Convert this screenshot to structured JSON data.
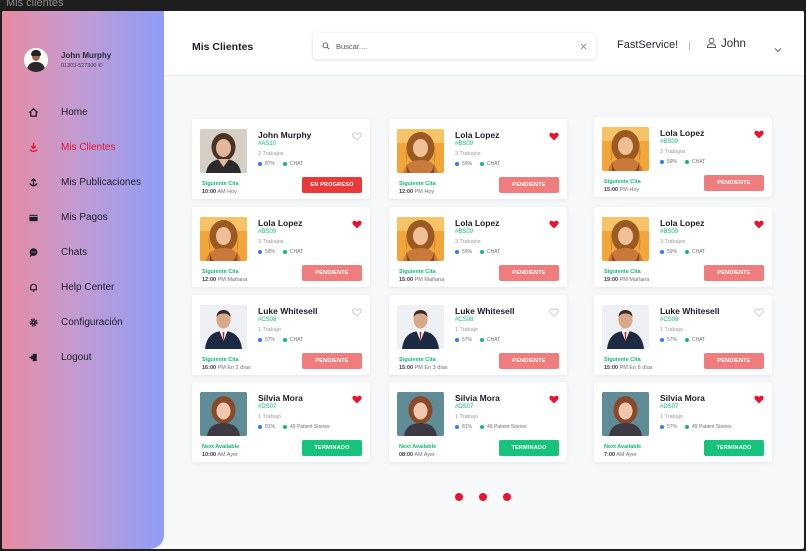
{
  "window": {
    "title": "Mis clientes"
  },
  "sidebar": {
    "profile": {
      "name": "John Murphy",
      "phone": "01303-527300"
    },
    "items": [
      {
        "label": "Home",
        "icon": "home-icon"
      },
      {
        "label": "Mis Clientes",
        "icon": "download-icon",
        "active": true
      },
      {
        "label": "Mis Publicaciones",
        "icon": "anchor-icon"
      },
      {
        "label": "Mis Pagos",
        "icon": "wallet-icon"
      },
      {
        "label": "Chats",
        "icon": "chat-icon"
      },
      {
        "label": "Help Center",
        "icon": "bell-icon"
      },
      {
        "label": "Configuración",
        "icon": "gear-icon"
      },
      {
        "label": "Logout",
        "icon": "logout-icon"
      }
    ]
  },
  "header": {
    "title": "Mis Clientes",
    "search_placeholder": "Buscar....",
    "brand": "FastService!",
    "user": "John"
  },
  "colors": {
    "accent": "#e8132f",
    "green": "#13b873",
    "blue": "#2f7cf6",
    "progress": "#e83a3a",
    "pending": "#f07d7d",
    "done": "#17c27b"
  },
  "cards": [
    {
      "name": "John Murphy",
      "code": "#AS10",
      "jobs": "2 Trabajos",
      "stat1": "87%",
      "stat2": "CHAT",
      "next_label": "Siguiente Cita",
      "next_time": "10:00",
      "next_when": "AM Hoy",
      "status": "EN PROGRESO",
      "favorite": false,
      "photo": "woman-dark"
    },
    {
      "name": "Lola Lopez",
      "code": "#BS09",
      "jobs": "3 Trabajos",
      "stat1": "59%",
      "stat2": "CHAT",
      "next_label": "Siguiente Cita",
      "next_time": "12:00",
      "next_when": "PM Hoy",
      "status": "PENDIENTE",
      "favorite": true,
      "photo": "woman-blonde"
    },
    {
      "name": "Lola Lopez",
      "code": "#BS09",
      "jobs": "3 Trabajos",
      "stat1": "59%",
      "stat2": "CHAT",
      "next_label": "Siguiente Cita",
      "next_time": "15:00",
      "next_when": "PM Hoy",
      "status": "PENDIENTE",
      "favorite": true,
      "photo": "woman-blonde"
    },
    {
      "name": "Lola Lopez",
      "code": "#BS09",
      "jobs": "3 Trabajos",
      "stat1": "59%",
      "stat2": "CHAT",
      "next_label": "Siguiente Cita",
      "next_time": "12:00",
      "next_when": "PM Mañana",
      "status": "PENDIENTE",
      "favorite": true,
      "photo": "woman-blonde"
    },
    {
      "name": "Lola Lopez",
      "code": "#BS09",
      "jobs": "3 Trabajos",
      "stat1": "59%",
      "stat2": "CHAT",
      "next_label": "Siguiente Cita",
      "next_time": "15:00",
      "next_when": "PM Mañana",
      "status": "PENDIENTE",
      "favorite": true,
      "photo": "woman-blonde"
    },
    {
      "name": "Lola Lopez",
      "code": "#BS09",
      "jobs": "3 Trabajos",
      "stat1": "59%",
      "stat2": "CHAT",
      "next_label": "Siguiente Cita",
      "next_time": "19:00",
      "next_when": "PM Mañana",
      "status": "PENDIENTE",
      "favorite": true,
      "photo": "woman-blonde"
    },
    {
      "name": "Luke Whitesell",
      "code": "#CS08",
      "jobs": "1 Trabajo",
      "stat1": "57%",
      "stat2": "CHAT",
      "next_label": "Siguiente Cita",
      "next_time": "16:00",
      "next_when": "PM En 2 días",
      "status": "PENDIENTE",
      "favorite": false,
      "photo": "man-suit"
    },
    {
      "name": "Luke Whitesell",
      "code": "#CS08",
      "jobs": "1 Trabajo",
      "stat1": "57%",
      "stat2": "CHAT",
      "next_label": "Siguiente Cita",
      "next_time": "15:00",
      "next_when": "PM En 3 días",
      "status": "PENDIENTE",
      "favorite": false,
      "photo": "man-suit"
    },
    {
      "name": "Luke Whitesell",
      "code": "#CS08",
      "jobs": "1 Trabajo",
      "stat1": "57%",
      "stat2": "CHAT",
      "next_label": "Siguiente Cita",
      "next_time": "15:00",
      "next_when": "PM En 6 días",
      "status": "PENDIENTE",
      "favorite": false,
      "photo": "man-suit"
    },
    {
      "name": "Silvia Mora",
      "code": "#DS07",
      "jobs": "1 Trabajo",
      "stat1": "81%",
      "stat2": "49 Patient Stories",
      "next_label": "Next Available",
      "next_time": "10:00",
      "next_when": "AM Ayer",
      "status": "TERMINADO",
      "favorite": true,
      "photo": "woman-red"
    },
    {
      "name": "Silvia Mora",
      "code": "#DS07",
      "jobs": "1 Trabajo",
      "stat1": "81%",
      "stat2": "49 Patient Stories",
      "next_label": "Next Available",
      "next_time": "08:00",
      "next_when": "AM Ayer",
      "status": "TERMINADO",
      "favorite": true,
      "photo": "woman-red"
    },
    {
      "name": "Silvia Mora",
      "code": "#DS07",
      "jobs": "1 Trabajo",
      "stat1": "57%",
      "stat2": "49 Patient Stories",
      "next_label": "Next Available",
      "next_time": "7:00",
      "next_when": "AM Ayer",
      "status": "TERMINADO",
      "favorite": true,
      "photo": "woman-red"
    }
  ],
  "pagination": {
    "pages": 3
  }
}
